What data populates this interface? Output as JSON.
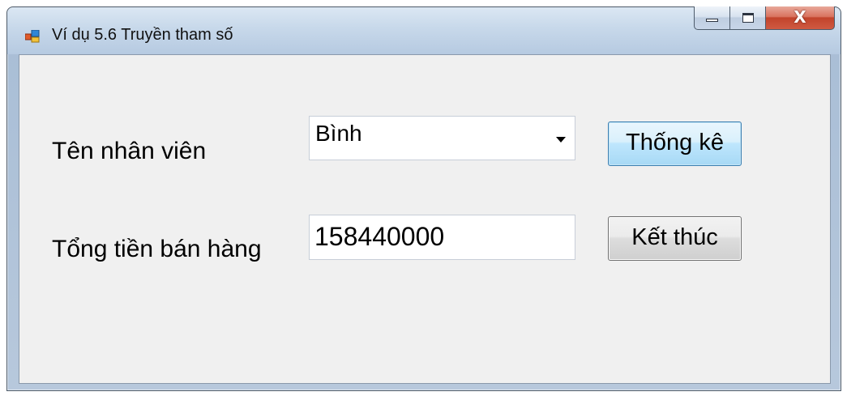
{
  "window": {
    "title": "Ví dụ 5.6 Truyền tham số",
    "icon": "app-form-icon",
    "controls": {
      "minimize_icon": "minimize-icon",
      "maximize_icon": "maximize-icon",
      "close_label": "X"
    }
  },
  "form": {
    "employee_label": "Tên nhân viên",
    "employee_value": "Bình",
    "total_label": "Tổng tiền bán hàng",
    "total_value": "158440000",
    "stat_button": "Thống kê",
    "exit_button": "Kết thúc"
  },
  "colors": {
    "client_background": "#f0f0f0",
    "close_button": "#c2432b",
    "focused_button": "#bee6fd"
  }
}
